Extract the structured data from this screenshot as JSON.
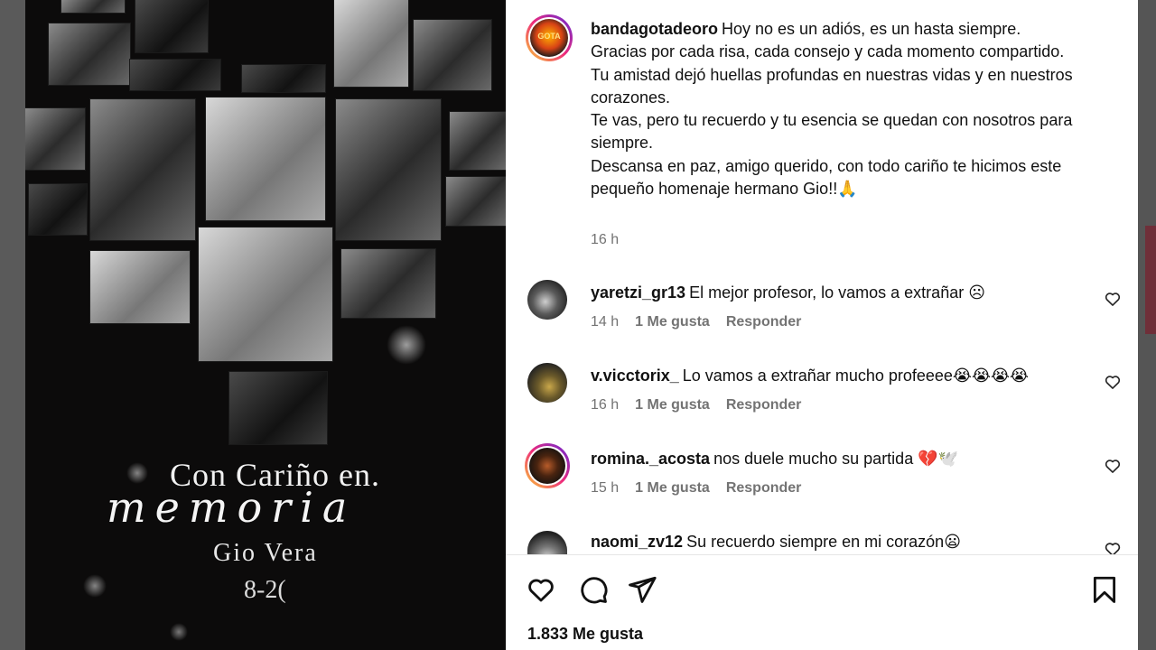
{
  "post": {
    "memorial": {
      "title_line": "Con Cariño en.",
      "script_line": "memoria",
      "name": "Gio Vera",
      "years": "8-2("
    }
  },
  "caption": {
    "username": "bandagotadeoro",
    "avatar_text": "GOTA",
    "lines": [
      "Hoy no es un adiós, es un hasta siempre.",
      "Gracias por cada risa, cada consejo y cada momento compartido.",
      "Tu amistad dejó huellas profundas en nuestras vidas y en nuestros corazones.",
      "Te vas, pero tu recuerdo y tu esencia se quedan con nosotros para siempre.",
      "Descansa en paz, amigo querido, con todo cariño te hicimos este pequeño homenaje hermano Gio!!🙏"
    ],
    "time": "16 h"
  },
  "comments": [
    {
      "username": "yaretzi_gr13",
      "text": "El mejor profesor, lo vamos a extrañar ☹",
      "time": "14 h",
      "likes": "1 Me gusta",
      "reply": "Responder"
    },
    {
      "username": "v.vicctorix_",
      "text": "Lo vamos a extrañar mucho profeeee😭😭😭😭",
      "time": "16 h",
      "likes": "1 Me gusta",
      "reply": "Responder"
    },
    {
      "username": "romina._acosta",
      "text": "nos duele mucho su partida 💔🕊️",
      "time": "15 h",
      "likes": "1 Me gusta",
      "reply": "Responder"
    },
    {
      "username": "naomi_zv12",
      "text": "Su recuerdo siempre en mi corazón😦",
      "time": "",
      "likes": "",
      "reply": ""
    }
  ],
  "footer": {
    "likes_count": "1.833 Me gusta"
  },
  "icons": {
    "like": "heart-icon",
    "comment": "comment-icon",
    "share": "send-icon",
    "save": "bookmark-icon"
  },
  "colors": {
    "muted": "#737373",
    "story_ring": "#ee2a7b"
  }
}
